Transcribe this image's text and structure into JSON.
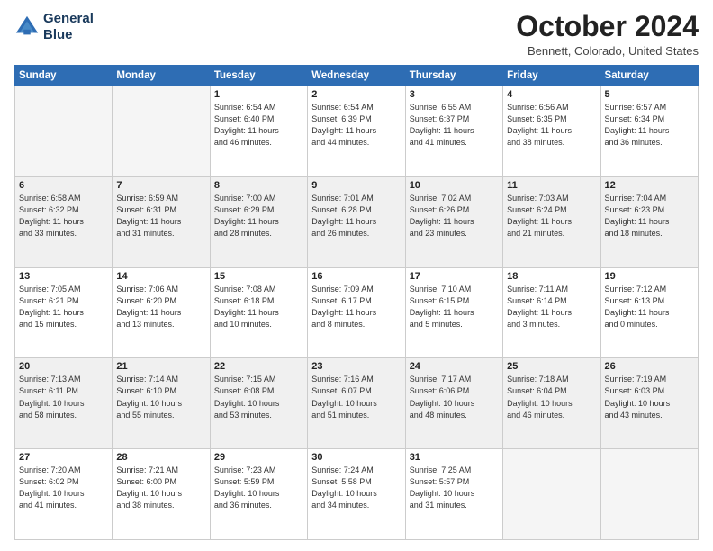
{
  "header": {
    "logo_line1": "General",
    "logo_line2": "Blue",
    "month": "October 2024",
    "location": "Bennett, Colorado, United States"
  },
  "days_of_week": [
    "Sunday",
    "Monday",
    "Tuesday",
    "Wednesday",
    "Thursday",
    "Friday",
    "Saturday"
  ],
  "weeks": [
    [
      {
        "day": "",
        "info": ""
      },
      {
        "day": "",
        "info": ""
      },
      {
        "day": "1",
        "info": "Sunrise: 6:54 AM\nSunset: 6:40 PM\nDaylight: 11 hours\nand 46 minutes."
      },
      {
        "day": "2",
        "info": "Sunrise: 6:54 AM\nSunset: 6:39 PM\nDaylight: 11 hours\nand 44 minutes."
      },
      {
        "day": "3",
        "info": "Sunrise: 6:55 AM\nSunset: 6:37 PM\nDaylight: 11 hours\nand 41 minutes."
      },
      {
        "day": "4",
        "info": "Sunrise: 6:56 AM\nSunset: 6:35 PM\nDaylight: 11 hours\nand 38 minutes."
      },
      {
        "day": "5",
        "info": "Sunrise: 6:57 AM\nSunset: 6:34 PM\nDaylight: 11 hours\nand 36 minutes."
      }
    ],
    [
      {
        "day": "6",
        "info": "Sunrise: 6:58 AM\nSunset: 6:32 PM\nDaylight: 11 hours\nand 33 minutes."
      },
      {
        "day": "7",
        "info": "Sunrise: 6:59 AM\nSunset: 6:31 PM\nDaylight: 11 hours\nand 31 minutes."
      },
      {
        "day": "8",
        "info": "Sunrise: 7:00 AM\nSunset: 6:29 PM\nDaylight: 11 hours\nand 28 minutes."
      },
      {
        "day": "9",
        "info": "Sunrise: 7:01 AM\nSunset: 6:28 PM\nDaylight: 11 hours\nand 26 minutes."
      },
      {
        "day": "10",
        "info": "Sunrise: 7:02 AM\nSunset: 6:26 PM\nDaylight: 11 hours\nand 23 minutes."
      },
      {
        "day": "11",
        "info": "Sunrise: 7:03 AM\nSunset: 6:24 PM\nDaylight: 11 hours\nand 21 minutes."
      },
      {
        "day": "12",
        "info": "Sunrise: 7:04 AM\nSunset: 6:23 PM\nDaylight: 11 hours\nand 18 minutes."
      }
    ],
    [
      {
        "day": "13",
        "info": "Sunrise: 7:05 AM\nSunset: 6:21 PM\nDaylight: 11 hours\nand 15 minutes."
      },
      {
        "day": "14",
        "info": "Sunrise: 7:06 AM\nSunset: 6:20 PM\nDaylight: 11 hours\nand 13 minutes."
      },
      {
        "day": "15",
        "info": "Sunrise: 7:08 AM\nSunset: 6:18 PM\nDaylight: 11 hours\nand 10 minutes."
      },
      {
        "day": "16",
        "info": "Sunrise: 7:09 AM\nSunset: 6:17 PM\nDaylight: 11 hours\nand 8 minutes."
      },
      {
        "day": "17",
        "info": "Sunrise: 7:10 AM\nSunset: 6:15 PM\nDaylight: 11 hours\nand 5 minutes."
      },
      {
        "day": "18",
        "info": "Sunrise: 7:11 AM\nSunset: 6:14 PM\nDaylight: 11 hours\nand 3 minutes."
      },
      {
        "day": "19",
        "info": "Sunrise: 7:12 AM\nSunset: 6:13 PM\nDaylight: 11 hours\nand 0 minutes."
      }
    ],
    [
      {
        "day": "20",
        "info": "Sunrise: 7:13 AM\nSunset: 6:11 PM\nDaylight: 10 hours\nand 58 minutes."
      },
      {
        "day": "21",
        "info": "Sunrise: 7:14 AM\nSunset: 6:10 PM\nDaylight: 10 hours\nand 55 minutes."
      },
      {
        "day": "22",
        "info": "Sunrise: 7:15 AM\nSunset: 6:08 PM\nDaylight: 10 hours\nand 53 minutes."
      },
      {
        "day": "23",
        "info": "Sunrise: 7:16 AM\nSunset: 6:07 PM\nDaylight: 10 hours\nand 51 minutes."
      },
      {
        "day": "24",
        "info": "Sunrise: 7:17 AM\nSunset: 6:06 PM\nDaylight: 10 hours\nand 48 minutes."
      },
      {
        "day": "25",
        "info": "Sunrise: 7:18 AM\nSunset: 6:04 PM\nDaylight: 10 hours\nand 46 minutes."
      },
      {
        "day": "26",
        "info": "Sunrise: 7:19 AM\nSunset: 6:03 PM\nDaylight: 10 hours\nand 43 minutes."
      }
    ],
    [
      {
        "day": "27",
        "info": "Sunrise: 7:20 AM\nSunset: 6:02 PM\nDaylight: 10 hours\nand 41 minutes."
      },
      {
        "day": "28",
        "info": "Sunrise: 7:21 AM\nSunset: 6:00 PM\nDaylight: 10 hours\nand 38 minutes."
      },
      {
        "day": "29",
        "info": "Sunrise: 7:23 AM\nSunset: 5:59 PM\nDaylight: 10 hours\nand 36 minutes."
      },
      {
        "day": "30",
        "info": "Sunrise: 7:24 AM\nSunset: 5:58 PM\nDaylight: 10 hours\nand 34 minutes."
      },
      {
        "day": "31",
        "info": "Sunrise: 7:25 AM\nSunset: 5:57 PM\nDaylight: 10 hours\nand 31 minutes."
      },
      {
        "day": "",
        "info": ""
      },
      {
        "day": "",
        "info": ""
      }
    ]
  ]
}
